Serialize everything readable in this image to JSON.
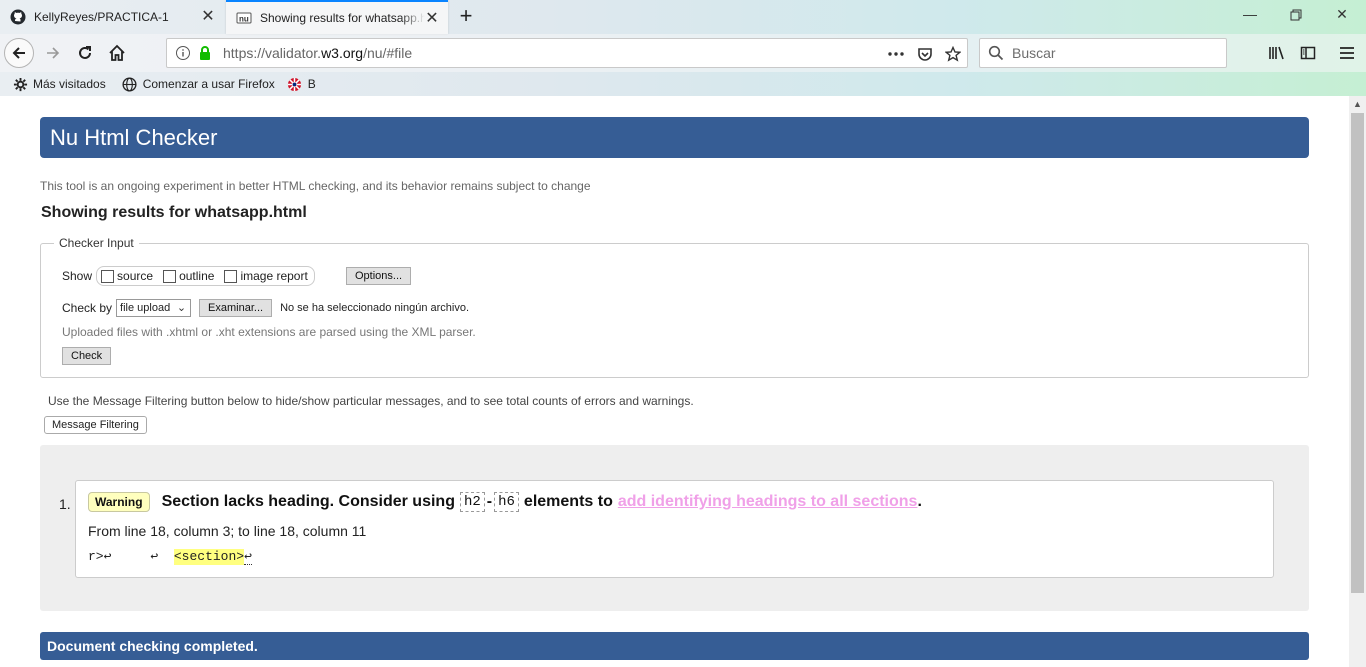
{
  "browser": {
    "tabs": [
      {
        "title": "KellyReyes/PRACTICA-1",
        "icon": "github-icon"
      },
      {
        "title": "Showing results for whatsapp.html",
        "icon": "w3c-validator-icon",
        "active": true
      }
    ],
    "url_prefix": "https://validator.",
    "url_domain": "w3.org",
    "url_path": "/nu/#file",
    "search_placeholder": "Buscar",
    "bookmarks": [
      {
        "label": "Más visitados",
        "icon": "gear-icon"
      },
      {
        "label": "Comenzar a usar Firefox",
        "icon": "globe-icon"
      },
      {
        "label": "B",
        "icon": "flag-icon"
      }
    ]
  },
  "page": {
    "banner_title": "Nu Html Checker",
    "disclaimer": "This tool is an ongoing experiment in better HTML checking, and its behavior remains subject to change",
    "results_heading": "Showing results for whatsapp.html",
    "checker_input": {
      "legend": "Checker Input",
      "show_label": "Show",
      "options": [
        "source",
        "outline",
        "image report"
      ],
      "options_button": "Options...",
      "check_by_label": "Check by",
      "check_by_value": "file upload",
      "browse_button": "Examinar...",
      "no_file_text": "No se ha seleccionado ningún archivo.",
      "xml_note": "Uploaded files with .xhtml or .xht extensions are parsed using the XML parser.",
      "check_button": "Check"
    },
    "filter_note": "Use the Message Filtering button below to hide/show particular messages, and to see total counts of errors and warnings.",
    "filter_button": "Message Filtering",
    "messages": [
      {
        "number": "1.",
        "type": "Warning",
        "text_before": "Section lacks heading. Consider using",
        "code1": "h2",
        "dash": "-",
        "code2": "h6",
        "text_middle": "elements to",
        "link": "add identifying headings to all sections",
        "text_end": ".",
        "location": "From line 18, column 3; to line 18, column 11",
        "extract_before": "r>↩     ↩  ",
        "extract_highlight": "<section>",
        "extract_after": "↩"
      }
    ],
    "completed": "Document checking completed."
  }
}
